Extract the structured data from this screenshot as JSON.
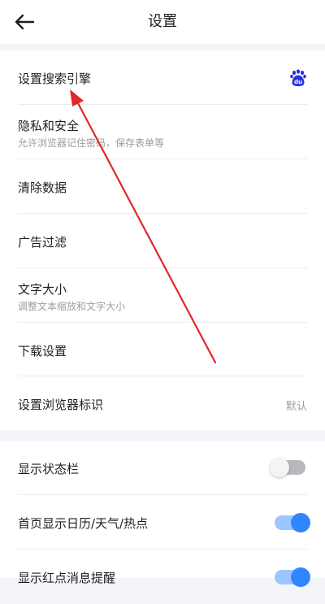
{
  "header": {
    "title": "设置",
    "back_icon": "arrow-left-icon"
  },
  "section1": {
    "items": [
      {
        "label": "设置搜索引擎",
        "icon": "baidu-logo-icon",
        "icon_text": "du"
      },
      {
        "label": "隐私和安全",
        "sub": "允许浏览器记住密码，保存表单等"
      },
      {
        "label": "清除数据"
      },
      {
        "label": "广告过滤"
      },
      {
        "label": "文字大小",
        "sub": "调整文本缩放和文字大小"
      },
      {
        "label": "下载设置"
      },
      {
        "label": "设置浏览器标识",
        "value": "默认"
      }
    ]
  },
  "section2": {
    "items": [
      {
        "label": "显示状态栏",
        "toggle": false
      },
      {
        "label": "首页显示日历/天气/热点",
        "toggle": true
      },
      {
        "label": "显示红点消息提醒",
        "toggle": true
      }
    ]
  },
  "colors": {
    "accent": "#2f86ff",
    "annotation_arrow": "#e0282b",
    "baidu_blue": "#2932e1"
  }
}
